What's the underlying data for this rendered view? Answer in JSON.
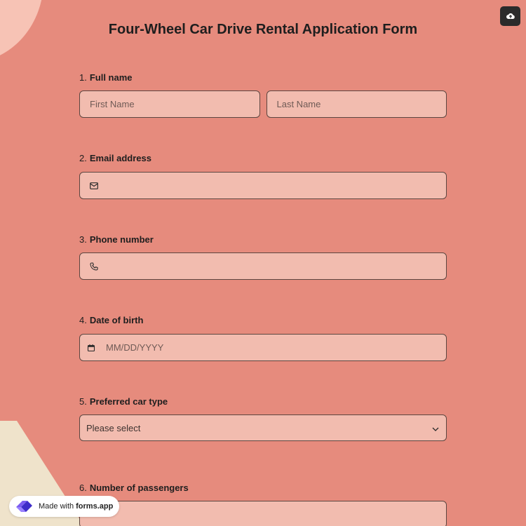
{
  "form": {
    "title": "Four-Wheel Car Drive Rental Application Form",
    "questions": [
      {
        "num": "1.",
        "label": "Full name",
        "first_placeholder": "First Name",
        "last_placeholder": "Last Name"
      },
      {
        "num": "2.",
        "label": "Email address",
        "icon": "envelope-icon"
      },
      {
        "num": "3.",
        "label": "Phone number",
        "icon": "phone-icon"
      },
      {
        "num": "4.",
        "label": "Date of birth",
        "icon": "calendar-icon",
        "placeholder": "MM/DD/YYYY"
      },
      {
        "num": "5.",
        "label": "Preferred car type",
        "value": "Please select",
        "icon": "chevron-down-icon"
      },
      {
        "num": "6.",
        "label": "Number of passengers"
      }
    ]
  },
  "badge": {
    "prefix": "Made with",
    "brand": "forms.app"
  },
  "colors": {
    "background": "#e68b7d",
    "field": "#f2bcaf",
    "accent_top": "#f7c3b5",
    "accent_bottom": "#efe3cb"
  }
}
